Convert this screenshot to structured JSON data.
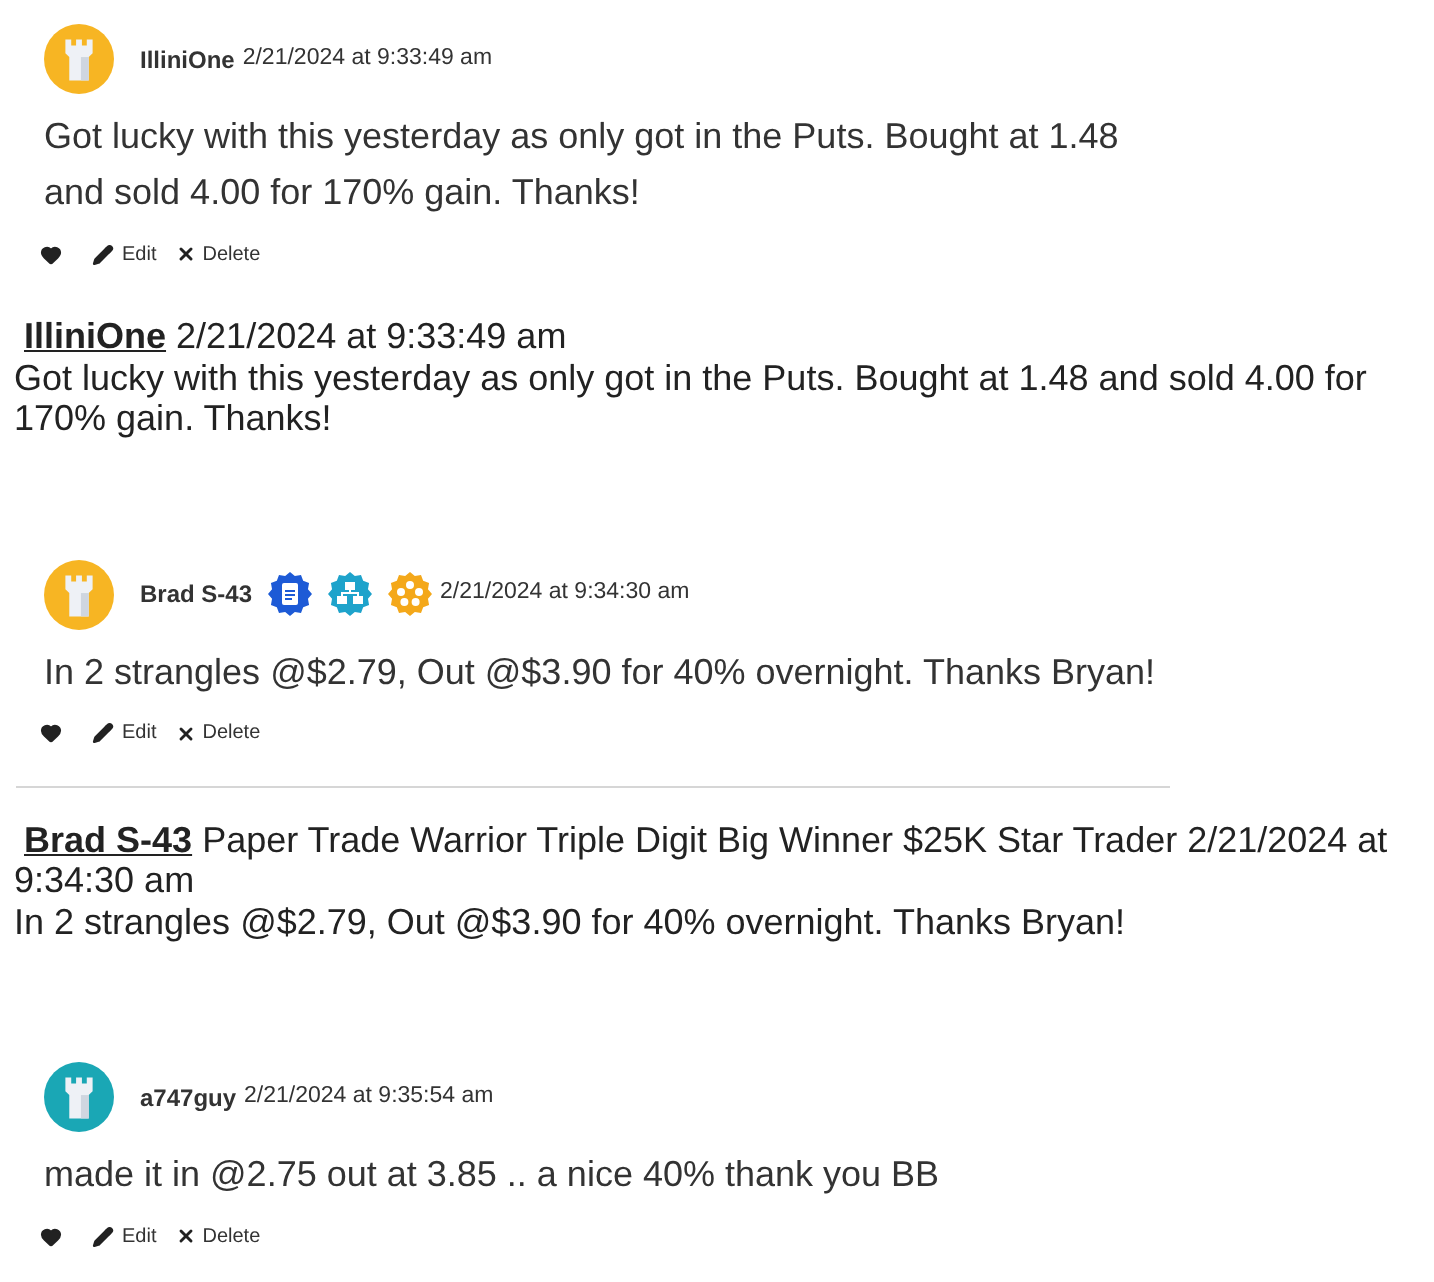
{
  "comments": [
    {
      "kind": "card",
      "author": "IlliniOne",
      "color": "#f7b523",
      "timestamp": "2/21/2024 at 9:33:49 am",
      "text": "Got lucky with this yesterday as only got in the Puts. Bought at 1.48 and sold 4.00 for 170% gain. Thanks!",
      "actions": [
        "Edit",
        "Delete"
      ]
    },
    {
      "kind": "plain",
      "author": "IlliniOne",
      "details": "2/21/2024 at 9:33:49 am",
      "text": "Got lucky with this yesterday as only got in the Puts. Bought at 1.48 and sold 4.00 for 170% gain. Thanks!"
    },
    {
      "kind": "card",
      "author": "Brad S-43",
      "color": "#f7b523",
      "badges": [
        {
          "kind": "document",
          "color": "#1d5ad6"
        },
        {
          "kind": "network",
          "color": "#1ea3cb"
        },
        {
          "kind": "dots",
          "color": "#f4a81a"
        }
      ],
      "timestamp": "2/21/2024 at 9:34:30 am",
      "text": "In 2 strangles @$2.79, Out @$3.90 for 40% overnight. Thanks Bryan!",
      "actions": [
        "Edit",
        "Delete"
      ]
    },
    {
      "kind": "divider"
    },
    {
      "kind": "plain",
      "author": "Brad S-43",
      "details": "Paper Trade Warrior Triple Digit Big Winner $25K Star Trader 2/21/2024 at 9:34:30 am",
      "text": "In 2 strangles @$2.79, Out @$3.90 for 40% overnight. Thanks Bryan!"
    },
    {
      "kind": "card",
      "author": "a747guy",
      "color": "#1aa7b5",
      "timestamp": "2/21/2024 at 9:35:54 am",
      "text": "made it in @2.75 out at 3.85 .. a nice 40% thank you BB",
      "actions": [
        "Edit",
        "Delete"
      ]
    }
  ]
}
